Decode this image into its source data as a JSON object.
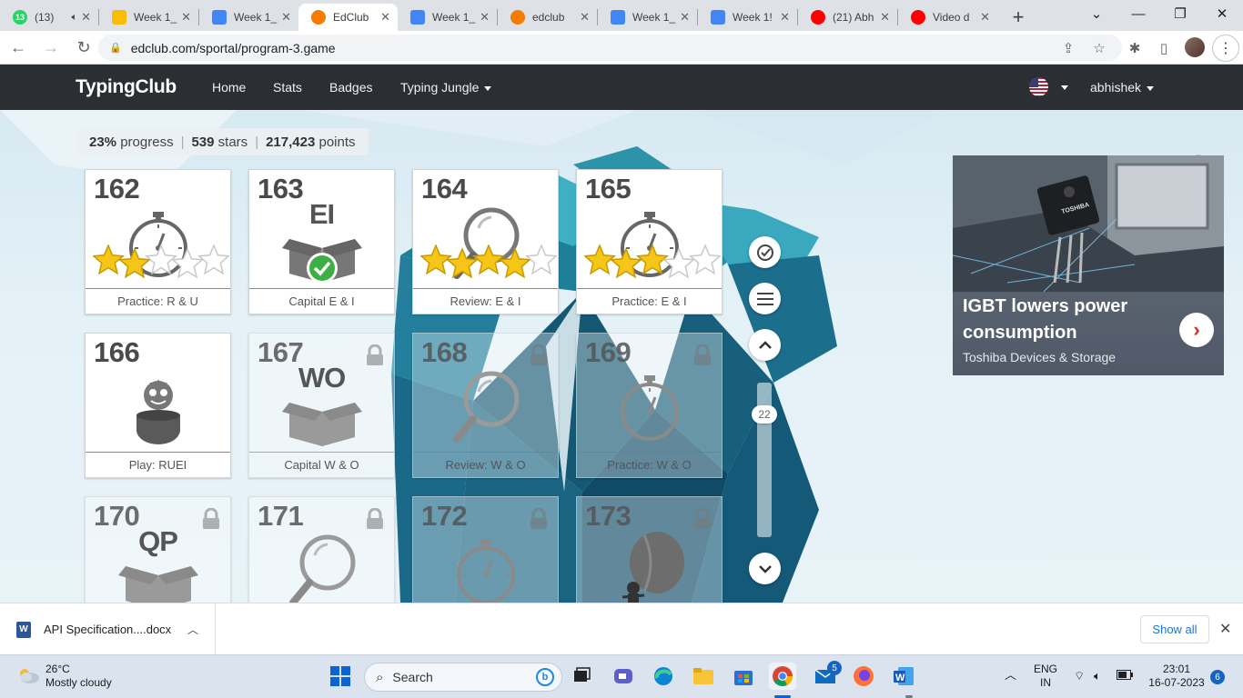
{
  "browser": {
    "tabs": [
      {
        "label": "(13)",
        "favicon": "whatsapp-icon",
        "color": "#25d366",
        "badge": "13",
        "audio": true
      },
      {
        "label": "Week 1_",
        "favicon": "google-drive-icon",
        "color": "#fbbc04"
      },
      {
        "label": "Week 1_",
        "favicon": "google-docs-icon",
        "color": "#4285f4"
      },
      {
        "label": "EdClub",
        "favicon": "edclub-icon",
        "color": "#f57c00",
        "active": true
      },
      {
        "label": "Week 1_",
        "favicon": "google-docs-icon",
        "color": "#4285f4"
      },
      {
        "label": "edclub",
        "favicon": "edclub-icon",
        "color": "#f57c00"
      },
      {
        "label": "Week 1_",
        "favicon": "google-docs-icon",
        "color": "#4285f4"
      },
      {
        "label": "Week 1!",
        "favicon": "google-docs-icon",
        "color": "#4285f4"
      },
      {
        "label": "(21) Abh",
        "favicon": "youtube-icon",
        "color": "#ff0000"
      },
      {
        "label": "Video d",
        "favicon": "youtube-icon",
        "color": "#ff0000"
      }
    ],
    "url": "edclub.com/sportal/program-3.game"
  },
  "site": {
    "brand": "TypingClub",
    "nav": [
      "Home",
      "Stats",
      "Badges",
      "Typing Jungle"
    ],
    "user": "abhishek"
  },
  "progress": {
    "percent": "23%",
    "percent_label": "progress",
    "stars": "539",
    "stars_label": "stars",
    "points": "217,423",
    "points_label": "points"
  },
  "lessons": [
    {
      "num": "162",
      "label": "Practice: R & U",
      "kind": "stopwatch",
      "stars": 2,
      "locked": false
    },
    {
      "num": "163",
      "label": "Capital E & I",
      "kind": "box",
      "box_text": "EI",
      "done": true,
      "locked": false
    },
    {
      "num": "164",
      "label": "Review: E & I",
      "kind": "magnifier",
      "stars": 4,
      "locked": false
    },
    {
      "num": "165",
      "label": "Practice: E & I",
      "kind": "stopwatch",
      "stars": 3,
      "locked": false
    },
    {
      "num": "166",
      "label": "Play: RUEI",
      "kind": "game",
      "locked": false
    },
    {
      "num": "167",
      "label": "Capital W & O",
      "kind": "box",
      "box_text": "WO",
      "locked": true
    },
    {
      "num": "168",
      "label": "Review: W & O",
      "kind": "magnifier",
      "locked": true
    },
    {
      "num": "169",
      "label": "Practice: W & O",
      "kind": "stopwatch",
      "locked": true
    },
    {
      "num": "170",
      "label": "",
      "kind": "box",
      "box_text": "QP",
      "locked": true
    },
    {
      "num": "171",
      "label": "",
      "kind": "magnifier",
      "locked": true
    },
    {
      "num": "172",
      "label": "",
      "kind": "stopwatch",
      "locked": true
    },
    {
      "num": "173",
      "label": "",
      "kind": "balloon",
      "locked": true
    }
  ],
  "scroller": {
    "value": "22"
  },
  "ad": {
    "headline": "IGBT lowers power consumption",
    "advertiser": "Toshiba Devices & Storage",
    "image_text": "TOSHIBA"
  },
  "download": {
    "filename": "API Specification....docx",
    "show_all": "Show all"
  },
  "taskbar": {
    "temp": "26°C",
    "weather": "Mostly cloudy",
    "search_placeholder": "Search",
    "lang": "ENG",
    "region": "IN",
    "time": "23:01",
    "date": "16-07-2023",
    "mail_badge": "5",
    "notif_badge": "6"
  }
}
